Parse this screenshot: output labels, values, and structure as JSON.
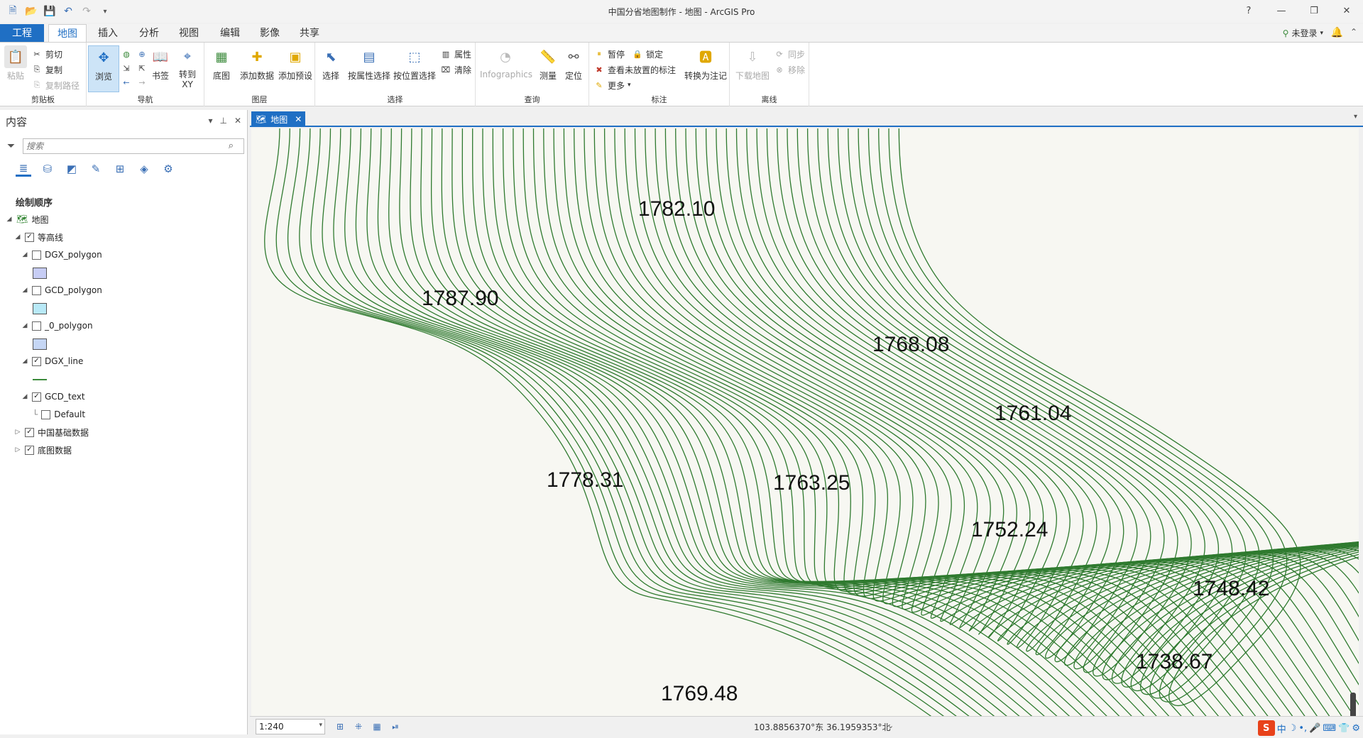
{
  "window": {
    "title": "中国分省地图制作 - 地图 - ArcGIS Pro"
  },
  "titlebar_buttons": {
    "help": "?",
    "minimize": "—",
    "restore": "❐",
    "close": "✕"
  },
  "tabs": [
    {
      "label": "工程"
    },
    {
      "label": "地图"
    },
    {
      "label": "插入"
    },
    {
      "label": "分析"
    },
    {
      "label": "视图"
    },
    {
      "label": "编辑"
    },
    {
      "label": "影像"
    },
    {
      "label": "共享"
    }
  ],
  "account": {
    "login": "未登录"
  },
  "ribbon": {
    "clipboard": {
      "paste": "粘贴",
      "cut": "剪切",
      "copy": "复制",
      "copy_path": "复制路径",
      "group": "剪贴板"
    },
    "navigate": {
      "explore": "浏览",
      "bookmarks": "书签",
      "goto_xy_1": "转到",
      "goto_xy_2": "XY",
      "group": "导航"
    },
    "layer": {
      "basemap": "底图",
      "add_data": "添加数据",
      "add_preset": "添加预设",
      "group": "图层"
    },
    "selection": {
      "select": "选择",
      "select_by_attr": "按属性选择",
      "select_by_loc": "按位置选择",
      "attributes": "属性",
      "clear": "清除",
      "group": "选择"
    },
    "inquiry": {
      "infographics": "Infographics",
      "measure": "测量",
      "locate": "定位",
      "group": "查询"
    },
    "labeling": {
      "pause": "暂停",
      "lock": "锁定",
      "view_unplaced": "查看未放置的标注",
      "more": "更多",
      "convert": "转换为注记",
      "group": "标注"
    },
    "offline": {
      "download": "下载地图",
      "sync": "同步",
      "remove": "移除",
      "group": "离线"
    }
  },
  "contents": {
    "title": "内容",
    "search_placeholder": "搜索",
    "drawing_order": "绘制顺序",
    "map": "地图",
    "layers": [
      {
        "name": "等高线",
        "checked": true
      },
      {
        "name": "DGX_polygon",
        "checked": false,
        "swatch": "#c7cdf5"
      },
      {
        "name": "GCD_polygon",
        "checked": false,
        "swatch": "#b8e9f7"
      },
      {
        "name": "_0_polygon",
        "checked": false,
        "swatch": "#c5d6f5"
      },
      {
        "name": "DGX_line",
        "checked": true,
        "line": "#3b8a3b"
      },
      {
        "name": "GCD_text",
        "checked": true
      },
      {
        "name": "Default",
        "checked": false
      },
      {
        "name": "中国基础数据",
        "checked": true
      },
      {
        "name": "底图数据",
        "checked": true
      }
    ]
  },
  "map_tab": {
    "label": "地图"
  },
  "map_labels": [
    {
      "text": "1782.10"
    },
    {
      "text": "1787.90"
    },
    {
      "text": "1768.08"
    },
    {
      "text": "1761.04"
    },
    {
      "text": "1778.31"
    },
    {
      "text": "1763.25"
    },
    {
      "text": "1752.24"
    },
    {
      "text": "1748.42"
    },
    {
      "text": "1738.67"
    },
    {
      "text": "1769.48"
    }
  ],
  "colors": {
    "contour": "#2f7a2f",
    "map_bg": "#f7f7f2",
    "accent": "#1f6fc4"
  },
  "statusbar": {
    "scale": "1:240",
    "coords": "103.8856370°东 36.1959353°北"
  },
  "ime": {
    "mode": "中"
  }
}
